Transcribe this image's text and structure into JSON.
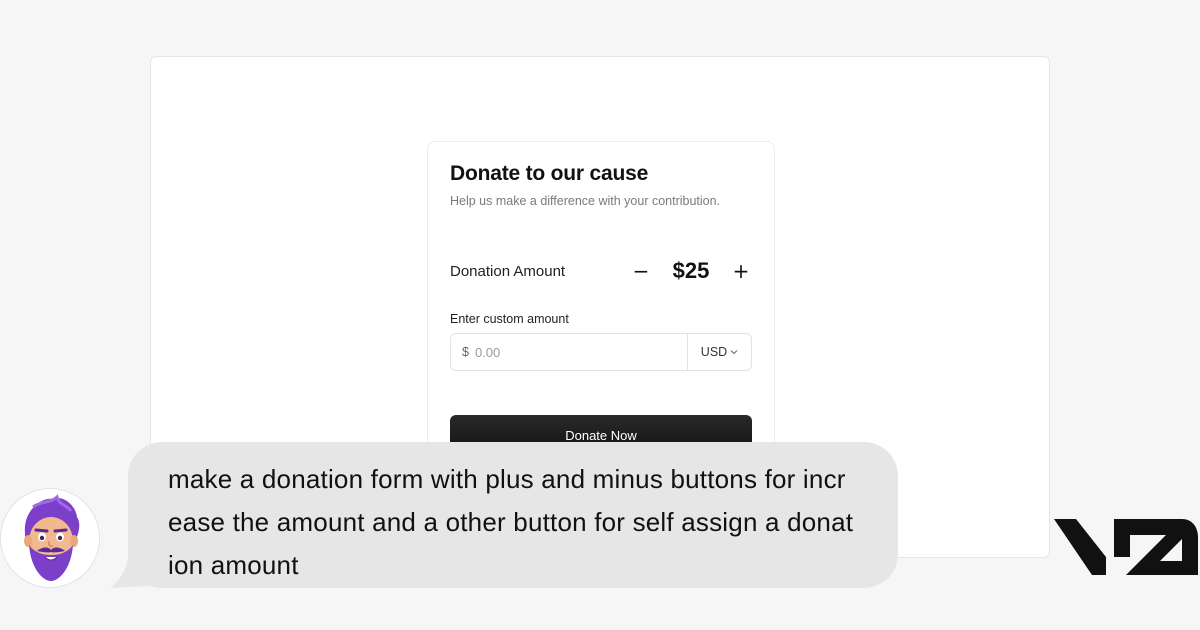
{
  "form": {
    "title": "Donate to our cause",
    "subtitle": "Help us make a difference with your contribution.",
    "amount_label": "Donation Amount",
    "minus_symbol": "−",
    "plus_symbol": "+",
    "amount_value": "$25",
    "custom_label": "Enter custom amount",
    "currency_symbol": "$",
    "custom_placeholder": "0.00",
    "currency": "USD",
    "donate_label": "Donate Now"
  },
  "chat": {
    "prompt": "make a donation form with plus and minus buttons for increase the amount and a other button for self assign a donation amount"
  },
  "colors": {
    "page_bg": "#f6f6f6",
    "bubble_bg": "#e6e6e6",
    "button_bg": "#1a1a1a",
    "avatar_accent": "#8b4fd6"
  },
  "icons": [
    "minus-icon",
    "plus-icon",
    "chevron-down-icon",
    "user-avatar",
    "v0-logo"
  ]
}
